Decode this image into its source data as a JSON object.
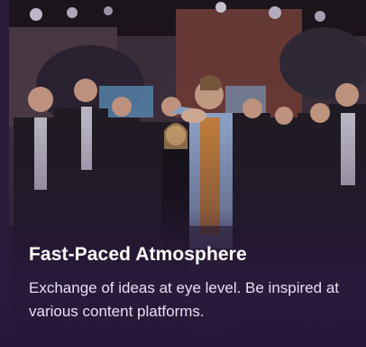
{
  "card": {
    "image_alt_icon": "event-photo",
    "title": "Fast-Paced Atmosphere",
    "description": "Exchange of ideas at eye level. Be inspired at various content platforms."
  },
  "colors": {
    "background": "#2a1c38",
    "title_text": "#ffffff",
    "body_text": "#e6e0ee"
  }
}
